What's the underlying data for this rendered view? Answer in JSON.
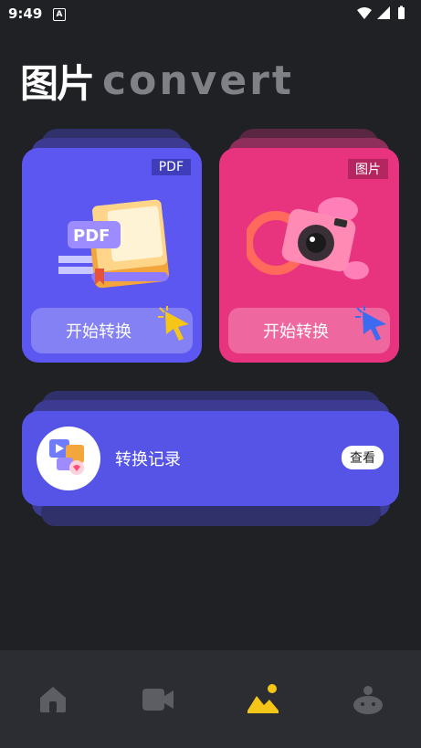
{
  "status_bar": {
    "time": "9:49",
    "notification_glyph": "A"
  },
  "header": {
    "logo_cn": "图片",
    "logo_en": "convert"
  },
  "cards": [
    {
      "tag": "PDF",
      "button_label": "开始转换",
      "color": "#5b57f0"
    },
    {
      "tag": "图片",
      "button_label": "开始转换",
      "color": "#e8347f"
    }
  ],
  "record": {
    "title": "转换记录",
    "view_label": "查看"
  },
  "nav": {
    "items": [
      {
        "icon": "home-icon",
        "active": false
      },
      {
        "icon": "video-icon",
        "active": false
      },
      {
        "icon": "image-icon",
        "active": true
      },
      {
        "icon": "profile-icon",
        "active": false
      }
    ],
    "active_color": "#f5c518",
    "inactive_color": "#5c5e63"
  }
}
